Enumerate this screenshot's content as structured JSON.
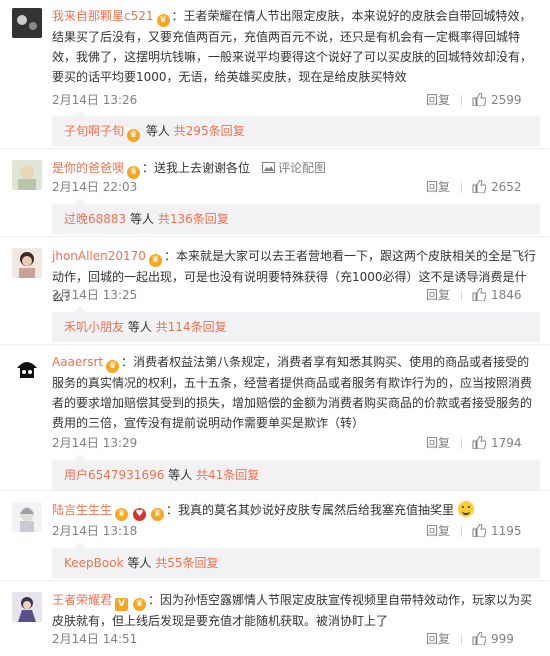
{
  "actions": {
    "reply": "回复"
  },
  "comments": [
    {
      "user": "我来自那颗星c521",
      "badges": [
        "crown"
      ],
      "text": "：王者荣耀在情人节出限定皮肤，本来说好的皮肤会自带回城特效，结果买了后没有，又要充值两百元，充值两百元不说，还只是有机会有一定概率得回城特效，我佛了，这摆明坑钱嘛，一般来说平均要得这个说好了可以买皮肤的回城特效却没有，要买的话平均要1000，无语，给英雄买皮肤，现在是给皮肤买特效",
      "time": "2月14日 13:26",
      "likes": "2599",
      "sub": {
        "who": "子旬啊子旬",
        "mid": "等人 ",
        "count": "共295条回复"
      }
    },
    {
      "user": "是你的爸爸噢",
      "badges": [
        "crown"
      ],
      "text": "：送我上去谢谢各位",
      "translate": "评论配图",
      "time": "2月14日 22:03",
      "likes": "2652",
      "sub": {
        "who": "过晚68883",
        "mid": "等人 ",
        "count": "共136条回复"
      }
    },
    {
      "user": "jhonAllen20170",
      "badges": [
        "crown"
      ],
      "text": "：本来就是大家可以去王者营地看一下，跟这两个皮肤相关的全是飞行动作，回城的一起出现，可是也没有说明要特殊获得（充1000必得）这不是诱导消费是什么？",
      "time": "2月14日 13:25",
      "likes": "1846",
      "sub": {
        "who": "禾叽小朋友",
        "mid": "等人 ",
        "count": "共114条回复"
      }
    },
    {
      "user": "Aaaersrt",
      "badges": [
        "crown"
      ],
      "text": "：消费者权益法第八条规定，消费者享有知悉其购买、使用的商品或者接受的服务的真实情况的权利，五十五条，经营者提供商品或者服务有欺诈行为的，应当按照消费者的要求增加赔偿其受到的损失，增加赔偿的金额为消费者购买商品的价款或者接受服务的费用的三倍，宣传没有提前说明动作需要单买是欺诈（转）",
      "time": "2月14日 13:29",
      "likes": "1794",
      "sub": {
        "who": "用户6547931696",
        "mid": "等人 ",
        "count": "共41条回复"
      }
    },
    {
      "user": "陆言生生生",
      "badges": [
        "crown",
        "red",
        "crown"
      ],
      "text": "：我真的莫名其妙说好皮肤专属然后给我塞充值抽奖里",
      "emoji": true,
      "time": "2月14日 13:18",
      "likes": "1195",
      "sub": {
        "who": "KeepBook",
        "mid": "等人 ",
        "count": "共55条回复"
      }
    },
    {
      "user": "王者荣耀君",
      "badges": [
        "v",
        "crown"
      ],
      "text": "：因为孙悟空露娜情人节限定皮肤宣传视频里自带特效动作，玩家以为买皮肤就有，但上线后发现是要充值才能随机获取。被消协盯上了",
      "time": "2月14日 14:51",
      "likes": "999"
    }
  ]
}
